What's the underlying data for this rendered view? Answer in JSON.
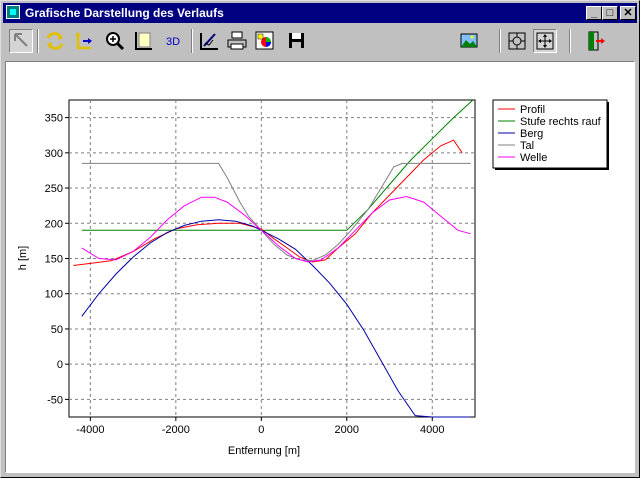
{
  "window": {
    "title": "Grafische Darstellung des Verlaufs"
  },
  "titlebar_buttons": {
    "minimize": "_",
    "maximize": "□",
    "close": "✕"
  },
  "toolbar": {
    "tools": [
      "select-tool",
      "refresh-tool",
      "move-axis-tool",
      "zoom-tool",
      "axis-tool",
      "3d-tool",
      "edit-tool",
      "print-tool",
      "color-tool",
      "save-tool",
      "image-tool",
      "zoom-fit-tool",
      "zoom-all-tool",
      "exit-tool"
    ],
    "label_3d": "3D"
  },
  "chart_data": {
    "type": "line",
    "xlabel": "Entfernung [m]",
    "ylabel": "h [m]",
    "xlim": [
      -4500,
      5000
    ],
    "ylim": [
      -75,
      375
    ],
    "xticks": [
      -4000,
      -2000,
      0,
      2000,
      4000
    ],
    "yticks": [
      -50,
      0,
      50,
      100,
      150,
      200,
      250,
      300,
      350
    ],
    "grid": true,
    "legend": "top-right outside",
    "series": [
      {
        "name": "Profil",
        "color": "#ff0000",
        "points": [
          [
            -4400,
            140
          ],
          [
            -4000,
            143
          ],
          [
            -3500,
            147
          ],
          [
            -3000,
            160
          ],
          [
            -2500,
            178
          ],
          [
            -2000,
            192
          ],
          [
            -1500,
            198
          ],
          [
            -1000,
            200
          ],
          [
            -500,
            200
          ],
          [
            0,
            192
          ],
          [
            300,
            178
          ],
          [
            600,
            165
          ],
          [
            900,
            152
          ],
          [
            1200,
            145
          ],
          [
            1500,
            148
          ],
          [
            1800,
            165
          ],
          [
            2200,
            185
          ],
          [
            2600,
            215
          ],
          [
            3000,
            240
          ],
          [
            3400,
            265
          ],
          [
            3800,
            290
          ],
          [
            4200,
            310
          ],
          [
            4500,
            318
          ],
          [
            4700,
            300
          ]
        ]
      },
      {
        "name": "Stufe rechts rauf",
        "color": "#008000",
        "points": [
          [
            -4200,
            190
          ],
          [
            2000,
            190
          ],
          [
            2500,
            220
          ],
          [
            3000,
            255
          ],
          [
            3500,
            290
          ],
          [
            4000,
            320
          ],
          [
            4500,
            350
          ],
          [
            4950,
            375
          ]
        ]
      },
      {
        "name": "Berg",
        "color": "#0000aa",
        "points": [
          [
            -4200,
            68
          ],
          [
            -3800,
            100
          ],
          [
            -3400,
            128
          ],
          [
            -3000,
            152
          ],
          [
            -2600,
            172
          ],
          [
            -2200,
            187
          ],
          [
            -1800,
            197
          ],
          [
            -1400,
            203
          ],
          [
            -1000,
            205
          ],
          [
            -600,
            203
          ],
          [
            -200,
            196
          ],
          [
            0,
            190
          ],
          [
            400,
            178
          ],
          [
            800,
            163
          ],
          [
            1200,
            140
          ],
          [
            1600,
            115
          ],
          [
            2000,
            85
          ],
          [
            2400,
            48
          ],
          [
            2800,
            5
          ],
          [
            3200,
            -38
          ],
          [
            3600,
            -73
          ],
          [
            4000,
            -75
          ],
          [
            4900,
            -75
          ]
        ]
      },
      {
        "name": "Tal",
        "color": "#808080",
        "points": [
          [
            -4200,
            285
          ],
          [
            -1000,
            285
          ],
          [
            -800,
            265
          ],
          [
            -500,
            230
          ],
          [
            -300,
            210
          ],
          [
            0,
            190
          ],
          [
            300,
            170
          ],
          [
            600,
            155
          ],
          [
            900,
            148
          ],
          [
            1200,
            147
          ],
          [
            1500,
            155
          ],
          [
            1800,
            170
          ],
          [
            2100,
            190
          ],
          [
            2500,
            220
          ],
          [
            2800,
            250
          ],
          [
            3100,
            280
          ],
          [
            3300,
            285
          ],
          [
            4900,
            285
          ]
        ]
      },
      {
        "name": "Welle",
        "color": "#ff00ff",
        "points": [
          [
            -4200,
            165
          ],
          [
            -3800,
            150
          ],
          [
            -3400,
            148
          ],
          [
            -3000,
            160
          ],
          [
            -2600,
            180
          ],
          [
            -2200,
            205
          ],
          [
            -1800,
            225
          ],
          [
            -1400,
            237
          ],
          [
            -1100,
            237
          ],
          [
            -800,
            230
          ],
          [
            -400,
            212
          ],
          [
            0,
            190
          ],
          [
            400,
            168
          ],
          [
            800,
            150
          ],
          [
            1100,
            145
          ],
          [
            1400,
            148
          ],
          [
            1800,
            165
          ],
          [
            2200,
            190
          ],
          [
            2600,
            215
          ],
          [
            3000,
            233
          ],
          [
            3400,
            238
          ],
          [
            3800,
            230
          ],
          [
            4200,
            210
          ],
          [
            4600,
            190
          ],
          [
            4900,
            185
          ]
        ]
      }
    ]
  }
}
